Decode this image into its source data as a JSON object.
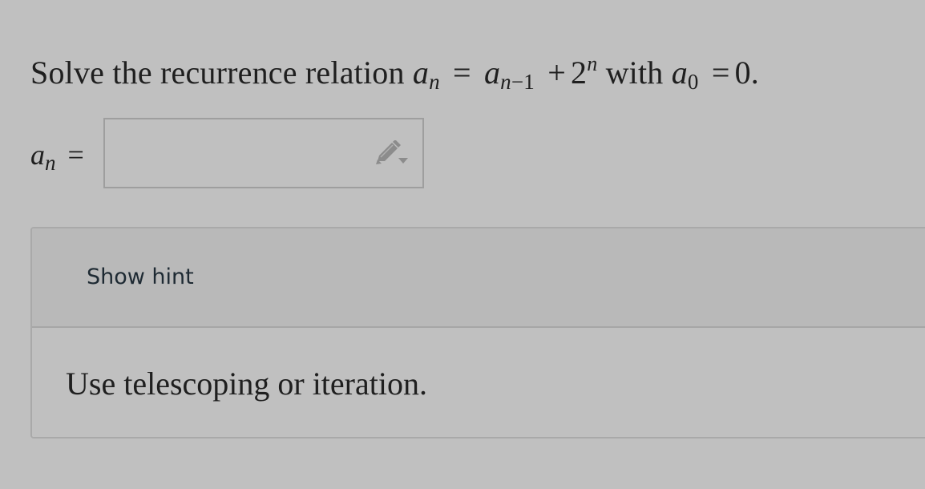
{
  "question": {
    "prefix": "Solve the recurrence relation",
    "lhs_var": "a",
    "lhs_sub": "n",
    "equals": "=",
    "rhs_var": "a",
    "rhs_sub_n": "n",
    "rhs_sub_rest": "−1",
    "plus": "+",
    "base": "2",
    "exponent": "n",
    "with": "with",
    "init_var": "a",
    "init_sub": "0",
    "init_equals": "=",
    "init_value": "0."
  },
  "answer": {
    "label_var": "a",
    "label_sub": "n",
    "label_equals": "=",
    "value": "",
    "placeholder": "",
    "editor_icon": "pencil-icon"
  },
  "hint": {
    "toggle_label": "Show hint",
    "text": "Use telescoping or iteration."
  }
}
